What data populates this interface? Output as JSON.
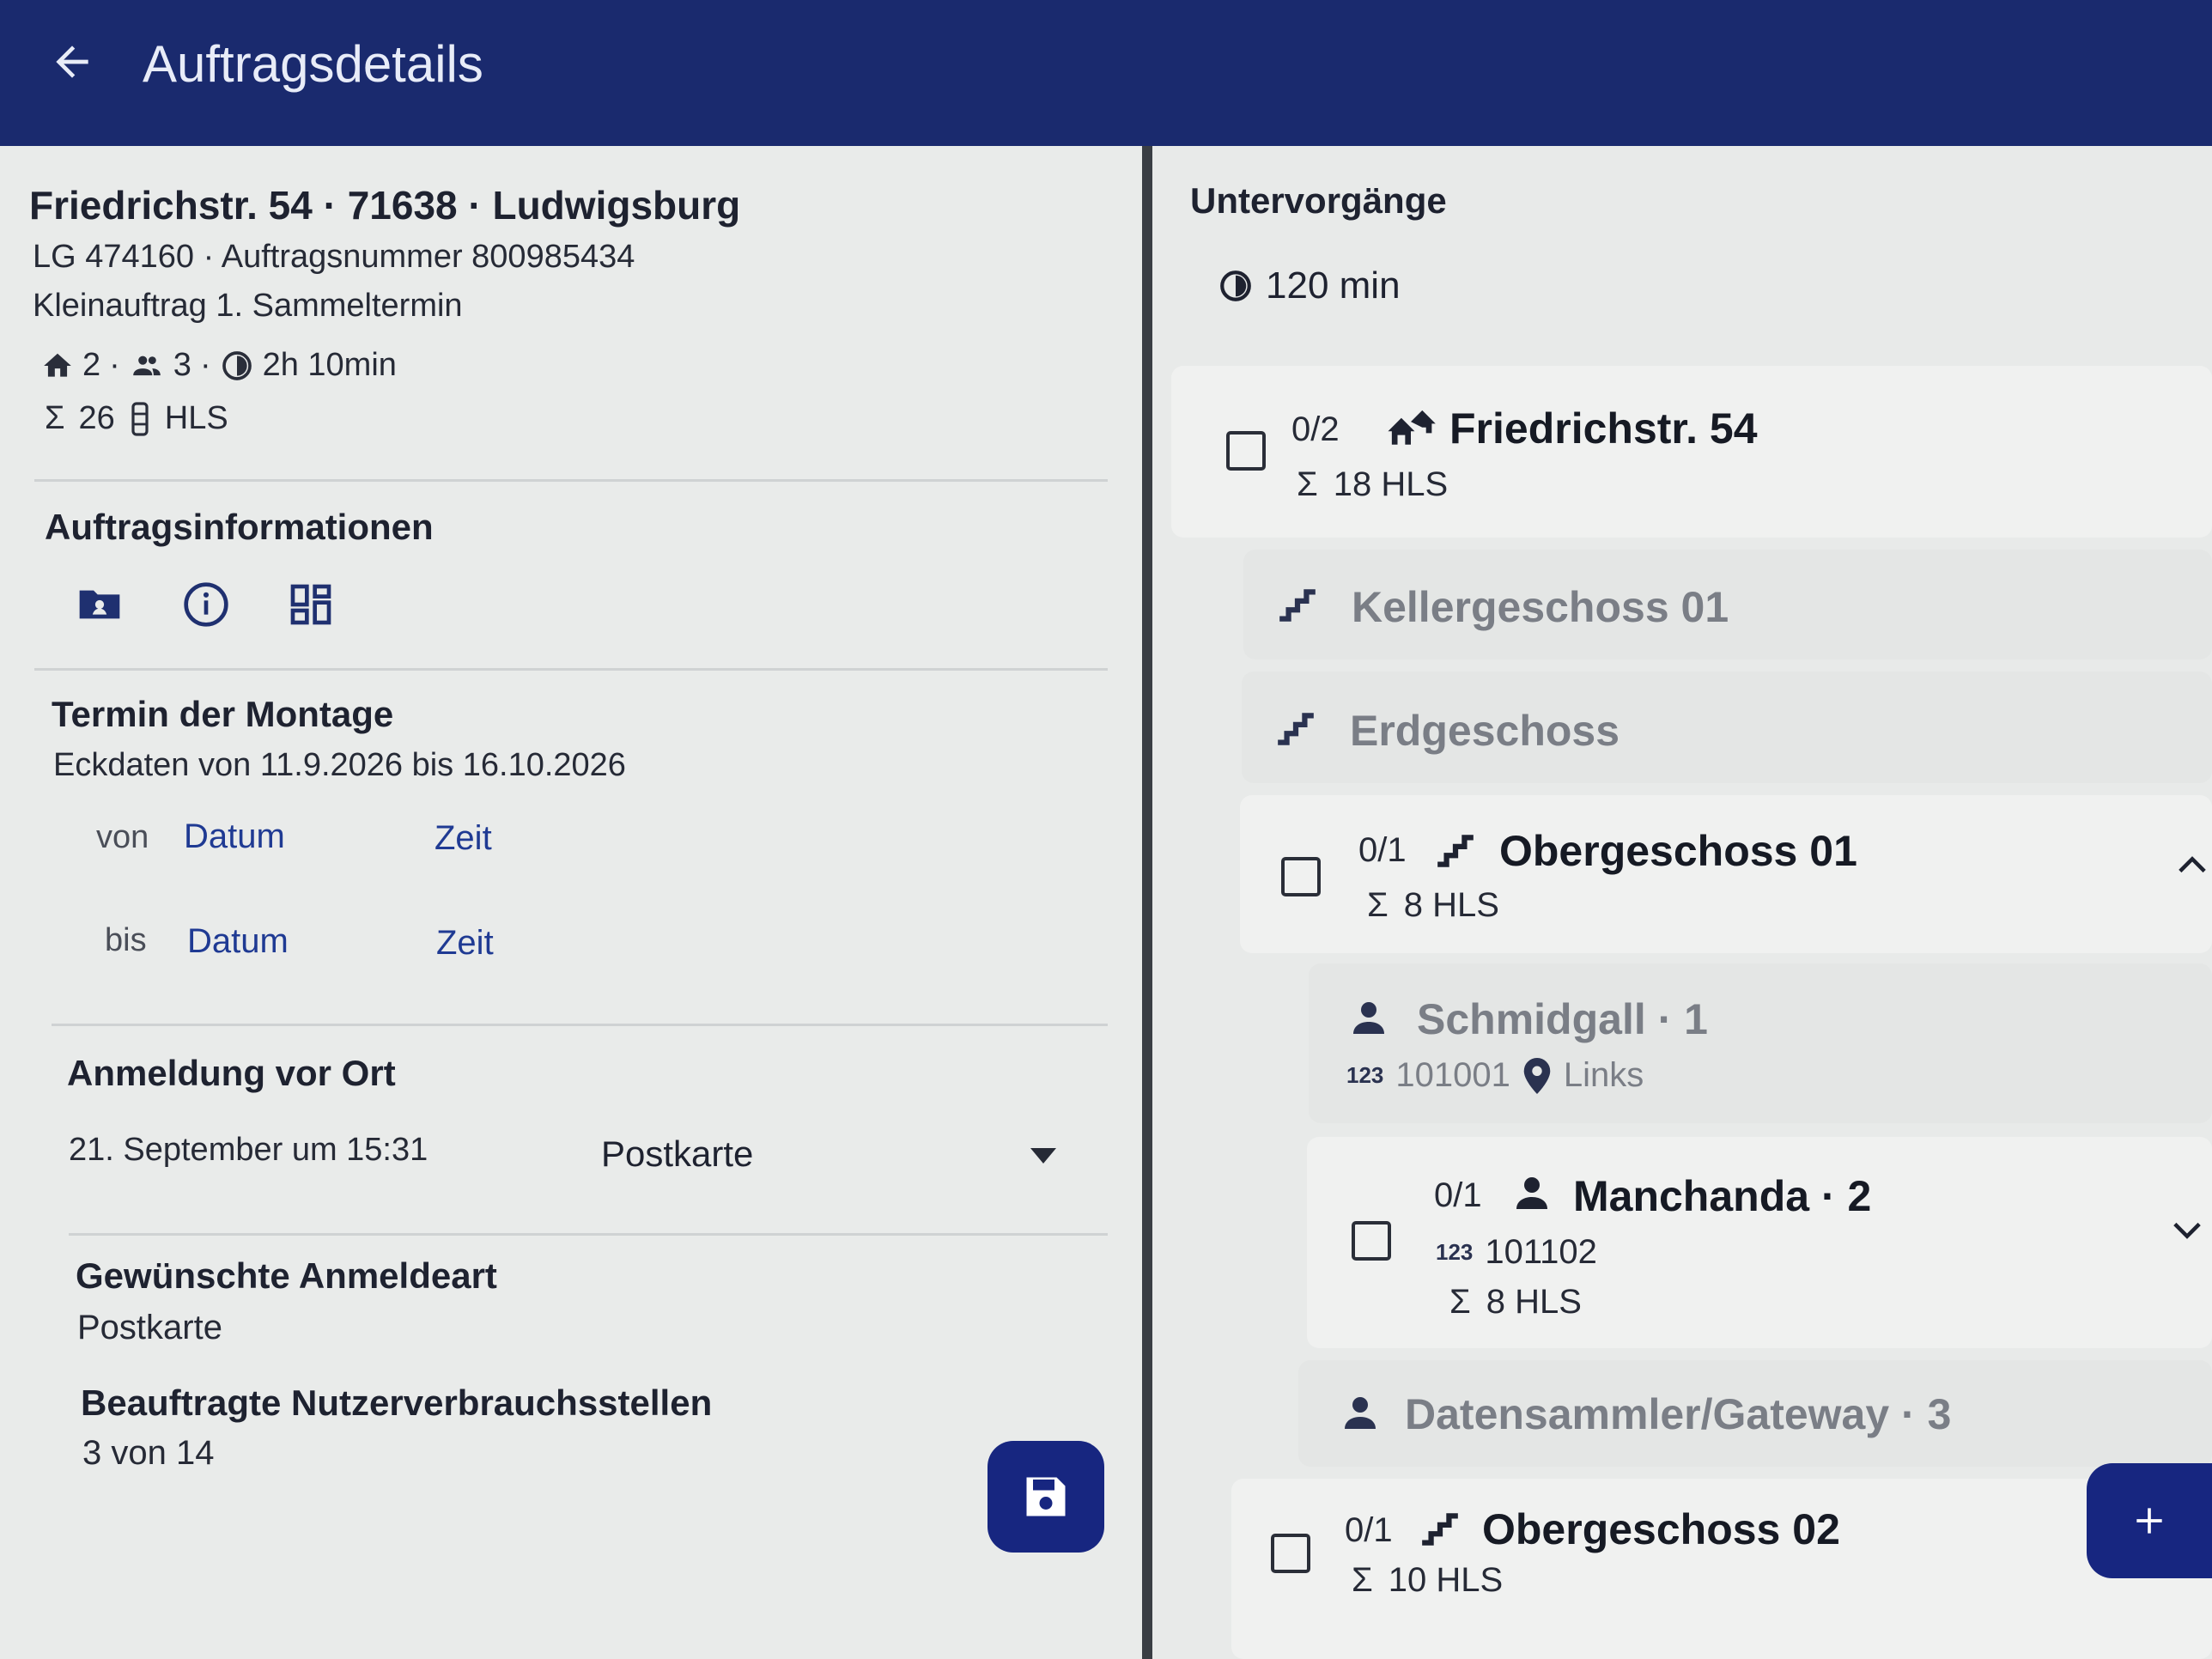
{
  "appbar": {
    "title": "Auftragsdetails"
  },
  "order": {
    "address": "Friedrichstr. 54 · 71638 · Ludwigsburg",
    "line2": "LG 474160 · Auftragsnummer 800985434",
    "line3": "Kleinauftrag 1. Sammeltermin",
    "houses": "2",
    "persons": "3",
    "duration": "2h 10min",
    "sum": "26",
    "hls": "HLS"
  },
  "info": {
    "title": "Auftragsinformationen"
  },
  "termin": {
    "title": "Termin der Montage",
    "eckdaten": "Eckdaten von 11.9.2026 bis 16.10.2026",
    "von": "von",
    "bis": "bis",
    "datum": "Datum",
    "zeit": "Zeit"
  },
  "anmeldung": {
    "title": "Anmeldung vor Ort",
    "datetime": "21. September um 15:31",
    "method": "Postkarte"
  },
  "gewuenscht": {
    "title": "Gewünschte Anmeldeart",
    "value": "Postkarte"
  },
  "beauftragt": {
    "title": "Beauftragte Nutzerverbrauchsstellen",
    "value": "3 von 14"
  },
  "sub": {
    "title": "Untervorgänge",
    "duration": "120 min",
    "items": [
      {
        "count": "0/2",
        "name": "Friedrichstr. 54",
        "sum": "18 HLS"
      },
      {
        "name": "Kellergeschoss 01"
      },
      {
        "name": "Erdgeschoss"
      },
      {
        "count": "0/1",
        "name": "Obergeschoss 01",
        "sum": "8 HLS"
      },
      {
        "name": "Schmidgall · 1",
        "num": "101001",
        "loc": "Links"
      },
      {
        "count": "0/1",
        "name": "Manchanda · 2",
        "num": "101102",
        "sum": "8 HLS"
      },
      {
        "name": "Datensammler/Gateway · 3"
      },
      {
        "count": "0/1",
        "name": "Obergeschoss 02",
        "sum": "10 HLS"
      }
    ]
  },
  "glyphs": {
    "sigma": "Σ",
    "dot": "·",
    "num123": "123"
  },
  "colors": {
    "appbar": "#1a2a6e",
    "fab": "#172680",
    "link": "#1f3a93"
  }
}
